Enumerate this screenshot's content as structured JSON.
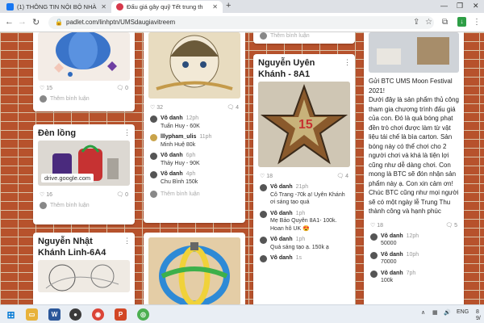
{
  "browser": {
    "tabs": [
      {
        "title": "(1) THÔNG TIN NỘI BỘ NHÀ",
        "favicon": "facebook-icon",
        "color": "#1877f2"
      },
      {
        "title": "Đấu giá gây quỹ Tết trung th",
        "favicon": "padlet-heart-icon",
        "color": "#d6384b"
      }
    ],
    "new_tab": "+",
    "url": "padlet.com/linhptn/UMSdaugiavitreem"
  },
  "board": {
    "col1_top": {
      "likes": "15",
      "comments": "0",
      "add_comment": "Thêm bình luận"
    },
    "den_long": {
      "title": "Đèn lồng",
      "link": "drive.google.com",
      "likes": "16",
      "comments": "0",
      "add_comment": "Thêm bình luận"
    },
    "khanh_linh": {
      "title": "Nguyễn Nhật Khánh Linh-6A4"
    },
    "col2_top": {
      "likes": "32",
      "comments": "4",
      "comments_list": [
        {
          "name": "Vô danh",
          "time": "12ph",
          "text": "Tuấn Huy - 60K"
        },
        {
          "name": "lllypham_ulis",
          "time": "11ph",
          "text": "Minh Huệ 80k"
        },
        {
          "name": "Vô danh",
          "time": "6ph",
          "text": "Thảy Huy - 90K"
        },
        {
          "name": "Vô danh",
          "time": "4ph",
          "text": "Chu Bình 150k"
        }
      ],
      "add_comment": "Thêm bình luận"
    },
    "uyen_khanh": {
      "title": "Nguyễn Uyên Khánh - 8A1",
      "top_add_comment": "Thêm bình luận",
      "likes": "18",
      "comments": "4",
      "comments_list": [
        {
          "name": "Vô danh",
          "time": "21ph",
          "text": "Cô Trang -70k ạ! Uyên Khánh ơi sáng tạo quá"
        },
        {
          "name": "Vô danh",
          "time": "1ph",
          "text": "Mẹ Bảo Quyên 8A1- 100k. Hoan hô UK 😍"
        },
        {
          "name": "Vô danh",
          "time": "1ph",
          "text": "Quá sáng tạo ạ. 150k ạ"
        },
        {
          "name": "Vô danh",
          "time": "1s",
          "text": ""
        }
      ]
    },
    "moon_festival": {
      "body": "Gửi BTC UMS Moon Festival 2021!\nDưới đây là sản phẩm thủ công tham gia chương trình đấu giá của con. Đó là quả bóng phạt đền trò chơi được làm từ vật liệu tái chế là bìa carton. Sản bóng này có thể chơi cho 2 người chơi và khá là tiện lợi cũng như dễ dàng chơi. Con mong là BTC sẽ đón nhận sản phẩm này ạ. Con xin cảm ơn!\n  Chúc BTC cũng như mọi người sẽ có một ngày lễ Trung Thu thành công và hạnh phúc",
      "likes": "18",
      "comments": "5",
      "comments_list": [
        {
          "name": "Vô danh",
          "time": "12ph",
          "text": "50000"
        },
        {
          "name": "Vô danh",
          "time": "10ph",
          "text": "70000"
        },
        {
          "name": "Vô danh",
          "time": "7ph",
          "text": "100k"
        }
      ]
    }
  },
  "taskbar": {
    "lang": "ENG",
    "time": "8",
    "date": "9/"
  },
  "colors": {
    "brick": "#b7522c",
    "mortar": "#d9c3a8",
    "card": "#ffffff"
  }
}
